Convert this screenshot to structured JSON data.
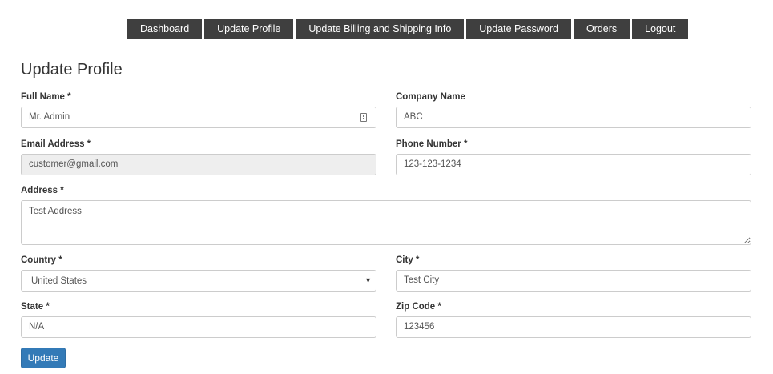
{
  "nav": {
    "items": [
      {
        "label": "Dashboard"
      },
      {
        "label": "Update Profile"
      },
      {
        "label": "Update Billing and Shipping Info"
      },
      {
        "label": "Update Password"
      },
      {
        "label": "Orders"
      },
      {
        "label": "Logout"
      }
    ]
  },
  "page": {
    "title": "Update Profile"
  },
  "form": {
    "full_name": {
      "label": "Full Name *",
      "value": "Mr. Admin"
    },
    "company_name": {
      "label": "Company Name",
      "value": "ABC"
    },
    "email": {
      "label": "Email Address *",
      "value": "customer@gmail.com"
    },
    "phone": {
      "label": "Phone Number *",
      "value": "123-123-1234"
    },
    "address": {
      "label": "Address *",
      "value": "Test Address"
    },
    "country": {
      "label": "Country *",
      "value": "United States"
    },
    "city": {
      "label": "City *",
      "value": "Test City"
    },
    "state": {
      "label": "State *",
      "value": "N/A"
    },
    "zip": {
      "label": "Zip Code *",
      "value": "123456"
    },
    "submit_label": "Update"
  },
  "icons": {
    "full_name_field": "contact-card-icon",
    "country_select": "caret-down-icon"
  },
  "colors": {
    "nav_bg": "#3f3f3f",
    "primary_button": "#337ab7",
    "disabled_field": "#eeeeee"
  }
}
